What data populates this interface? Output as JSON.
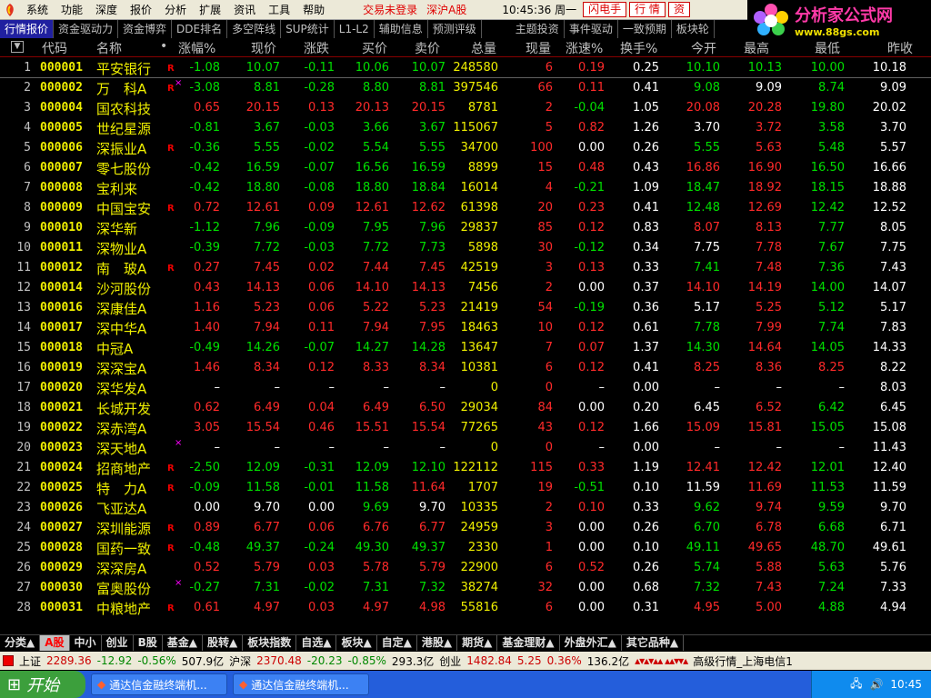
{
  "menu": {
    "items": [
      "系统",
      "功能",
      "深度",
      "报价",
      "分析",
      "扩展",
      "资讯",
      "工具",
      "帮助"
    ],
    "trade_status": "交易未登录",
    "market": "深沪A股",
    "time": "10:45:36 周一",
    "buttons": [
      "闪电手",
      "行 情",
      "资"
    ]
  },
  "logo": {
    "title": "分析家公式网",
    "url": "www.88gs.com"
  },
  "tabs": [
    "行情报价",
    "资金驱动力",
    "资金博弈",
    "DDE排名",
    "多空阵线",
    "SUP统计",
    "L1-L2",
    "辅助信息",
    "预测评级",
    "主题投资",
    "事件驱动",
    "一致预期",
    "板块轮"
  ],
  "columns": [
    "代码",
    "名称",
    "•",
    "涨幅%",
    "现价",
    "涨跌",
    "买价",
    "卖价",
    "总量",
    "现量",
    "涨速%",
    "换手%",
    "今开",
    "最高",
    "最低",
    "昨收"
  ],
  "stocks": [
    {
      "i": "1",
      "code": "000001",
      "name": "平安银行",
      "f": "R",
      "m": "",
      "pct": "-1.08",
      "price": "10.07",
      "chg": "-0.11",
      "bid": "10.06",
      "ask": "10.07",
      "vol": "248580",
      "cur": "6",
      "spd": "0.19",
      "turn": "0.25",
      "open": "10.10",
      "high": "10.13",
      "low": "10.00",
      "prev": "10.18"
    },
    {
      "i": "2",
      "code": "000002",
      "name": "万　科A",
      "f": "R",
      "m": "×",
      "pct": "-3.08",
      "price": "8.81",
      "chg": "-0.28",
      "bid": "8.80",
      "ask": "8.81",
      "vol": "397546",
      "cur": "66",
      "spd": "0.11",
      "turn": "0.41",
      "open": "9.08",
      "high": "9.09",
      "low": "8.74",
      "prev": "9.09"
    },
    {
      "i": "3",
      "code": "000004",
      "name": "国农科技",
      "f": "",
      "m": "",
      "pct": "0.65",
      "price": "20.15",
      "chg": "0.13",
      "bid": "20.13",
      "ask": "20.15",
      "vol": "8781",
      "cur": "2",
      "spd": "-0.04",
      "turn": "1.05",
      "open": "20.08",
      "high": "20.28",
      "low": "19.80",
      "prev": "20.02"
    },
    {
      "i": "4",
      "code": "000005",
      "name": "世纪星源",
      "f": "",
      "m": "",
      "pct": "-0.81",
      "price": "3.67",
      "chg": "-0.03",
      "bid": "3.66",
      "ask": "3.67",
      "vol": "115067",
      "cur": "5",
      "spd": "0.82",
      "turn": "1.26",
      "open": "3.70",
      "high": "3.72",
      "low": "3.58",
      "prev": "3.70"
    },
    {
      "i": "5",
      "code": "000006",
      "name": "深振业A",
      "f": "R",
      "m": "",
      "pct": "-0.36",
      "price": "5.55",
      "chg": "-0.02",
      "bid": "5.54",
      "ask": "5.55",
      "vol": "34700",
      "cur": "100",
      "spd": "0.00",
      "turn": "0.26",
      "open": "5.55",
      "high": "5.63",
      "low": "5.48",
      "prev": "5.57"
    },
    {
      "i": "6",
      "code": "000007",
      "name": "零七股份",
      "f": "",
      "m": "",
      "pct": "-0.42",
      "price": "16.59",
      "chg": "-0.07",
      "bid": "16.56",
      "ask": "16.59",
      "vol": "8899",
      "cur": "15",
      "spd": "0.48",
      "turn": "0.43",
      "open": "16.86",
      "high": "16.90",
      "low": "16.50",
      "prev": "16.66"
    },
    {
      "i": "7",
      "code": "000008",
      "name": "宝利来",
      "f": "",
      "m": "",
      "pct": "-0.42",
      "price": "18.80",
      "chg": "-0.08",
      "bid": "18.80",
      "ask": "18.84",
      "vol": "16014",
      "cur": "4",
      "spd": "-0.21",
      "turn": "1.09",
      "open": "18.47",
      "high": "18.92",
      "low": "18.15",
      "prev": "18.88"
    },
    {
      "i": "8",
      "code": "000009",
      "name": "中国宝安",
      "f": "R",
      "m": "",
      "pct": "0.72",
      "price": "12.61",
      "chg": "0.09",
      "bid": "12.61",
      "ask": "12.62",
      "vol": "61398",
      "cur": "20",
      "spd": "0.23",
      "turn": "0.41",
      "open": "12.48",
      "high": "12.69",
      "low": "12.42",
      "prev": "12.52"
    },
    {
      "i": "9",
      "code": "000010",
      "name": "深华新",
      "f": "",
      "m": "",
      "pct": "-1.12",
      "price": "7.96",
      "chg": "-0.09",
      "bid": "7.95",
      "ask": "7.96",
      "vol": "29837",
      "cur": "85",
      "spd": "0.12",
      "turn": "0.83",
      "open": "8.07",
      "high": "8.13",
      "low": "7.77",
      "prev": "8.05"
    },
    {
      "i": "10",
      "code": "000011",
      "name": "深物业A",
      "f": "",
      "m": "",
      "pct": "-0.39",
      "price": "7.72",
      "chg": "-0.03",
      "bid": "7.72",
      "ask": "7.73",
      "vol": "5898",
      "cur": "30",
      "spd": "-0.12",
      "turn": "0.34",
      "open": "7.75",
      "high": "7.78",
      "low": "7.67",
      "prev": "7.75"
    },
    {
      "i": "11",
      "code": "000012",
      "name": "南　玻A",
      "f": "R",
      "m": "",
      "pct": "0.27",
      "price": "7.45",
      "chg": "0.02",
      "bid": "7.44",
      "ask": "7.45",
      "vol": "42519",
      "cur": "3",
      "spd": "0.13",
      "turn": "0.33",
      "open": "7.41",
      "high": "7.48",
      "low": "7.36",
      "prev": "7.43"
    },
    {
      "i": "12",
      "code": "000014",
      "name": "沙河股份",
      "f": "",
      "m": "",
      "pct": "0.43",
      "price": "14.13",
      "chg": "0.06",
      "bid": "14.10",
      "ask": "14.13",
      "vol": "7456",
      "cur": "2",
      "spd": "0.00",
      "turn": "0.37",
      "open": "14.10",
      "high": "14.19",
      "low": "14.00",
      "prev": "14.07"
    },
    {
      "i": "13",
      "code": "000016",
      "name": "深康佳A",
      "f": "",
      "m": "",
      "pct": "1.16",
      "price": "5.23",
      "chg": "0.06",
      "bid": "5.22",
      "ask": "5.23",
      "vol": "21419",
      "cur": "54",
      "spd": "-0.19",
      "turn": "0.36",
      "open": "5.17",
      "high": "5.25",
      "low": "5.12",
      "prev": "5.17"
    },
    {
      "i": "14",
      "code": "000017",
      "name": "深中华A",
      "f": "",
      "m": "",
      "pct": "1.40",
      "price": "7.94",
      "chg": "0.11",
      "bid": "7.94",
      "ask": "7.95",
      "vol": "18463",
      "cur": "10",
      "spd": "0.12",
      "turn": "0.61",
      "open": "7.78",
      "high": "7.99",
      "low": "7.74",
      "prev": "7.83"
    },
    {
      "i": "15",
      "code": "000018",
      "name": "中冠A",
      "f": "",
      "m": "",
      "pct": "-0.49",
      "price": "14.26",
      "chg": "-0.07",
      "bid": "14.27",
      "ask": "14.28",
      "vol": "13647",
      "cur": "7",
      "spd": "0.07",
      "turn": "1.37",
      "open": "14.30",
      "high": "14.64",
      "low": "14.05",
      "prev": "14.33"
    },
    {
      "i": "16",
      "code": "000019",
      "name": "深深宝A",
      "f": "",
      "m": "",
      "pct": "1.46",
      "price": "8.34",
      "chg": "0.12",
      "bid": "8.33",
      "ask": "8.34",
      "vol": "10381",
      "cur": "6",
      "spd": "0.12",
      "turn": "0.41",
      "open": "8.25",
      "high": "8.36",
      "low": "8.25",
      "prev": "8.22"
    },
    {
      "i": "17",
      "code": "000020",
      "name": "深华发A",
      "f": "",
      "m": "",
      "pct": "–",
      "price": "–",
      "chg": "–",
      "bid": "–",
      "ask": "–",
      "vol": "0",
      "cur": "0",
      "spd": "–",
      "turn": "0.00",
      "open": "–",
      "high": "–",
      "low": "–",
      "prev": "8.03"
    },
    {
      "i": "18",
      "code": "000021",
      "name": "长城开发",
      "f": "",
      "m": "",
      "pct": "0.62",
      "price": "6.49",
      "chg": "0.04",
      "bid": "6.49",
      "ask": "6.50",
      "vol": "29034",
      "cur": "84",
      "spd": "0.00",
      "turn": "0.20",
      "open": "6.45",
      "high": "6.52",
      "low": "6.42",
      "prev": "6.45"
    },
    {
      "i": "19",
      "code": "000022",
      "name": "深赤湾A",
      "f": "",
      "m": "",
      "pct": "3.05",
      "price": "15.54",
      "chg": "0.46",
      "bid": "15.51",
      "ask": "15.54",
      "vol": "77265",
      "cur": "43",
      "spd": "0.12",
      "turn": "1.66",
      "open": "15.09",
      "high": "15.81",
      "low": "15.05",
      "prev": "15.08"
    },
    {
      "i": "20",
      "code": "000023",
      "name": "深天地A",
      "f": "",
      "m": "×",
      "pct": "–",
      "price": "–",
      "chg": "–",
      "bid": "–",
      "ask": "–",
      "vol": "0",
      "cur": "0",
      "spd": "–",
      "turn": "0.00",
      "open": "–",
      "high": "–",
      "low": "–",
      "prev": "11.43"
    },
    {
      "i": "21",
      "code": "000024",
      "name": "招商地产",
      "f": "R",
      "m": "",
      "pct": "-2.50",
      "price": "12.09",
      "chg": "-0.31",
      "bid": "12.09",
      "ask": "12.10",
      "vol": "122112",
      "cur": "115",
      "spd": "0.33",
      "turn": "1.19",
      "open": "12.41",
      "high": "12.42",
      "low": "12.01",
      "prev": "12.40"
    },
    {
      "i": "22",
      "code": "000025",
      "name": "特　力A",
      "f": "R",
      "m": "",
      "pct": "-0.09",
      "price": "11.58",
      "chg": "-0.01",
      "bid": "11.58",
      "ask": "11.64",
      "vol": "1707",
      "cur": "19",
      "spd": "-0.51",
      "turn": "0.10",
      "open": "11.59",
      "high": "11.69",
      "low": "11.53",
      "prev": "11.59"
    },
    {
      "i": "23",
      "code": "000026",
      "name": "飞亚达A",
      "f": "",
      "m": "",
      "pct": "0.00",
      "price": "9.70",
      "chg": "0.00",
      "bid": "9.69",
      "ask": "9.70",
      "vol": "10335",
      "cur": "2",
      "spd": "0.10",
      "turn": "0.33",
      "open": "9.62",
      "high": "9.74",
      "low": "9.59",
      "prev": "9.70"
    },
    {
      "i": "24",
      "code": "000027",
      "name": "深圳能源",
      "f": "R",
      "m": "",
      "pct": "0.89",
      "price": "6.77",
      "chg": "0.06",
      "bid": "6.76",
      "ask": "6.77",
      "vol": "24959",
      "cur": "3",
      "spd": "0.00",
      "turn": "0.26",
      "open": "6.70",
      "high": "6.78",
      "low": "6.68",
      "prev": "6.71"
    },
    {
      "i": "25",
      "code": "000028",
      "name": "国药一致",
      "f": "R",
      "m": "",
      "pct": "-0.48",
      "price": "49.37",
      "chg": "-0.24",
      "bid": "49.30",
      "ask": "49.37",
      "vol": "2330",
      "cur": "1",
      "spd": "0.00",
      "turn": "0.10",
      "open": "49.11",
      "high": "49.65",
      "low": "48.70",
      "prev": "49.61"
    },
    {
      "i": "26",
      "code": "000029",
      "name": "深深房A",
      "f": "",
      "m": "",
      "pct": "0.52",
      "price": "5.79",
      "chg": "0.03",
      "bid": "5.78",
      "ask": "5.79",
      "vol": "22900",
      "cur": "6",
      "spd": "0.52",
      "turn": "0.26",
      "open": "5.74",
      "high": "5.88",
      "low": "5.63",
      "prev": "5.76"
    },
    {
      "i": "27",
      "code": "000030",
      "name": "富奥股份",
      "f": "",
      "m": "×",
      "pct": "-0.27",
      "price": "7.31",
      "chg": "-0.02",
      "bid": "7.31",
      "ask": "7.32",
      "vol": "38274",
      "cur": "32",
      "spd": "0.00",
      "turn": "0.68",
      "open": "7.32",
      "high": "7.43",
      "low": "7.24",
      "prev": "7.33"
    },
    {
      "i": "28",
      "code": "000031",
      "name": "中粮地产",
      "f": "R",
      "m": "",
      "pct": "0.61",
      "price": "4.97",
      "chg": "0.03",
      "bid": "4.97",
      "ask": "4.98",
      "vol": "55816",
      "cur": "6",
      "spd": "0.00",
      "turn": "0.31",
      "open": "4.95",
      "high": "5.00",
      "low": "4.88",
      "prev": "4.94"
    }
  ],
  "bottom_tabs": [
    "分类▲",
    "A股",
    "中小",
    "创业",
    "B股",
    "基金▲",
    "股转▲",
    "板块指数",
    "自选▲",
    "板块▲",
    "自定▲",
    "港股▲",
    "期货▲",
    "基金理财▲",
    "外盘外汇▲",
    "其它品种▲"
  ],
  "status": {
    "sh_label": "上证",
    "sh_val": "2289.36",
    "sh_chg": "-12.92",
    "sh_pct": "-0.56%",
    "sh_amt": "507.9亿",
    "sz_label": "沪深",
    "sz_val": "2370.48",
    "sz_chg": "-20.23",
    "sz_pct": "-0.85%",
    "sz_amt": "293.3亿",
    "cy_label": "创业",
    "cy_val": "1482.84",
    "cy_chg": "5.25",
    "cy_pct": "0.36%",
    "cy_amt": "136.2亿",
    "feed": "高级行情_上海电信1"
  },
  "taskbar": {
    "start": "开始",
    "tasks": [
      "通达信金融终端机...",
      "通达信金融终端机..."
    ],
    "time": "10:45"
  },
  "colors": {
    "up": "#ff2a2a",
    "down": "#00e000",
    "flat": "#ffffff",
    "code": "#f0f000"
  }
}
